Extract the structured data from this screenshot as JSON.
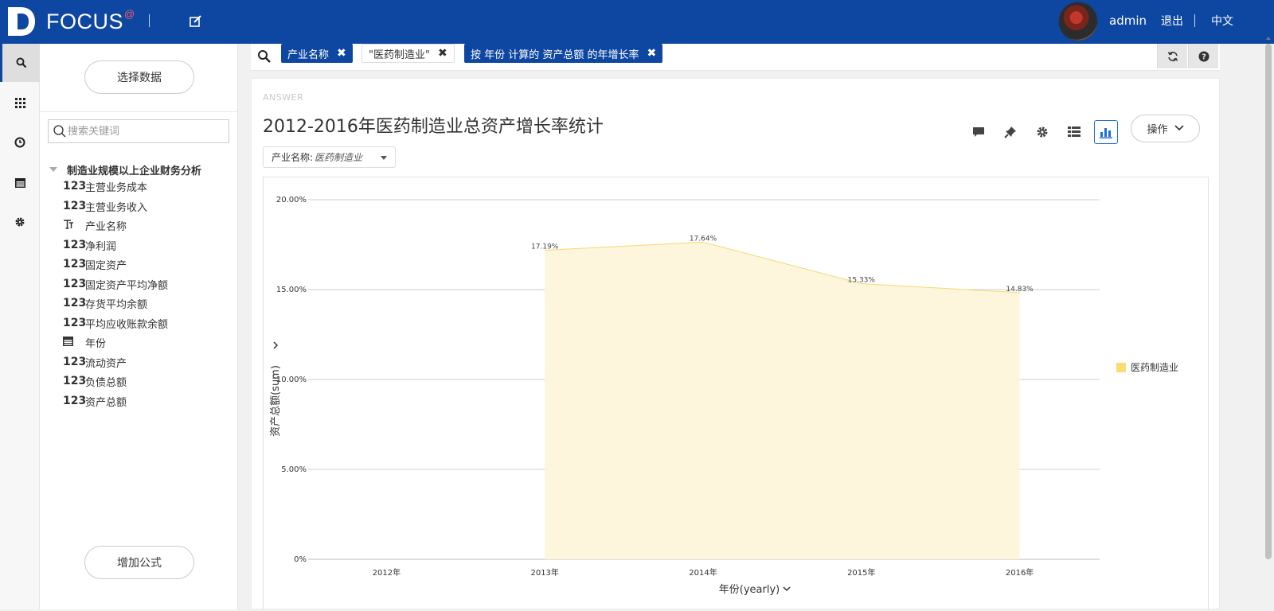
{
  "topbar": {
    "logo_text": "FOCUS",
    "logo_sup": "@",
    "user": "admin",
    "logout": "退出",
    "language": "中文"
  },
  "rail": {
    "items": [
      "search-icon",
      "grid-icon",
      "clock-icon",
      "calendar-icon",
      "gear-icon"
    ]
  },
  "sidebar": {
    "select_data": "选择数据",
    "search_placeholder": "搜索关键词",
    "tree_root": "制造业规模以上企业财务分析",
    "fields": [
      {
        "type": "123",
        "label": "主营业务成本"
      },
      {
        "type": "123",
        "label": "主营业务收入"
      },
      {
        "type": "T",
        "label": "产业名称"
      },
      {
        "type": "123",
        "label": "净利润"
      },
      {
        "type": "123",
        "label": "固定资产"
      },
      {
        "type": "123",
        "label": "固定资产平均净额"
      },
      {
        "type": "123",
        "label": "存货平均余额"
      },
      {
        "type": "123",
        "label": "平均应收账款余额"
      },
      {
        "type": "calendar",
        "label": "年份"
      },
      {
        "type": "123",
        "label": "流动资产"
      },
      {
        "type": "123",
        "label": "负债总额"
      },
      {
        "type": "123",
        "label": "资产总额"
      }
    ],
    "add_formula": "增加公式"
  },
  "filterbar": {
    "chips": [
      "产业名称",
      "\"医药制造业\"",
      "按 年份 计算的 资产总额 的年增长率"
    ]
  },
  "answer": {
    "tag": "ANSWER",
    "title": "2012-2016年医药制造业总资产增长率统计",
    "operations": "操作",
    "filter_label": "产业名称:",
    "filter_value": "医药制造业"
  },
  "colors": {
    "brand": "#0e47a1",
    "area_fill": "#fdf5dc",
    "area_line": "#f7d774",
    "legend": "#f9dc73"
  },
  "chart_data": {
    "type": "area",
    "categories": [
      "2012年",
      "2013年",
      "2014年",
      "2015年",
      "2016年"
    ],
    "series": [
      {
        "name": "医药制造业",
        "values": [
          null,
          17.19,
          17.64,
          15.33,
          14.83
        ]
      }
    ],
    "data_labels": [
      "",
      "17.19%",
      "17.64%",
      "15.33%",
      "14.83%"
    ],
    "y_ticks": [
      "0%",
      "5.00%",
      "10.00%",
      "15.00%",
      "20.00%"
    ],
    "ylim": [
      0,
      20
    ],
    "xlabel": "年份(yearly)",
    "ylabel": "资产总额(sum)",
    "grid": true,
    "legend_position": "right"
  }
}
